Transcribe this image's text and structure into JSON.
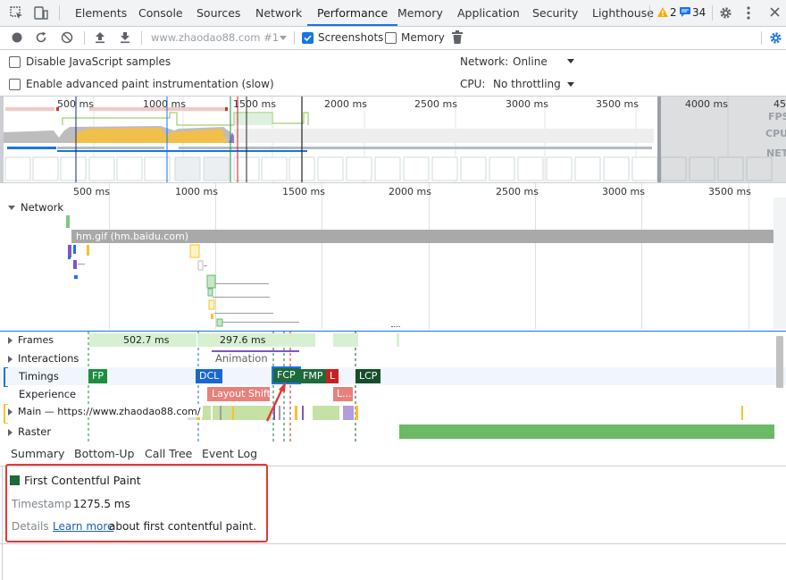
{
  "tabs": [
    {
      "label": "Elements"
    },
    {
      "label": "Console"
    },
    {
      "label": "Sources"
    },
    {
      "label": "Network"
    },
    {
      "label": "Performance"
    },
    {
      "label": "Memory"
    },
    {
      "label": "Application"
    },
    {
      "label": "Security"
    },
    {
      "label": "Lighthouse"
    }
  ],
  "active_tab": "Performance",
  "badges": {
    "warnings": "2",
    "messages": "34"
  },
  "toolbar": {
    "url_select": "www.zhaodao88.com #1",
    "screenshots_label": "Screenshots",
    "screenshots_checked": true,
    "memory_label": "Memory",
    "memory_checked": false
  },
  "settings": {
    "disable_js_samples": "Disable JavaScript samples",
    "advanced_paint": "Enable advanced paint instrumentation (slow)",
    "network_label": "Network:",
    "network_value": "Online",
    "cpu_label": "CPU:",
    "cpu_value": "No throttling"
  },
  "overview": {
    "ticks": [
      "500 ms",
      "1000 ms",
      "1500 ms",
      "2000 ms",
      "2500 ms",
      "3000 ms",
      "3500 ms",
      "4000 ms",
      "45"
    ],
    "lane_labels": [
      "FPS",
      "CPU",
      "NET"
    ]
  },
  "timeline": {
    "ticks": [
      "500 ms",
      "1000 ms",
      "1500 ms",
      "2000 ms",
      "2500 ms",
      "3000 ms",
      "3500 ms"
    ],
    "network_label": "Network",
    "request_label": "hm.gif (hm.baidu.com)"
  },
  "tracks": {
    "frames": "Frames",
    "frame_1": "502.7 ms",
    "frame_2": "297.6 ms",
    "interactions": "Interactions",
    "animation": "Animation",
    "timings": "Timings",
    "markers": [
      "FP",
      "DCL",
      "FCP",
      "FMP",
      "L",
      "LCP"
    ],
    "experience": "Experience",
    "layout_shift": "Layout Shift",
    "layout_shift_2": "L...",
    "main": "Main — https://www.zhaodao88.com/",
    "raster": "Raster"
  },
  "bottom_tabs": [
    "Summary",
    "Bottom-Up",
    "Call Tree",
    "Event Log"
  ],
  "summary": {
    "title": "First Contentful Paint",
    "timestamp_label": "Timestamp",
    "timestamp_value": "1275.5 ms",
    "details_label": "Details",
    "learn_more": "Learn more",
    "details_suffix": "about first contentful paint."
  },
  "colors": {
    "accent": "#1a73e8",
    "fcp_green": "#1e6a3a",
    "fp_green": "#1e8e3e",
    "dcl_blue": "#1967d2",
    "load_red": "#c5221f",
    "lcp_dark": "#174d2a",
    "layout_shift": "#e8817c",
    "annotation_red": "#e53935"
  }
}
